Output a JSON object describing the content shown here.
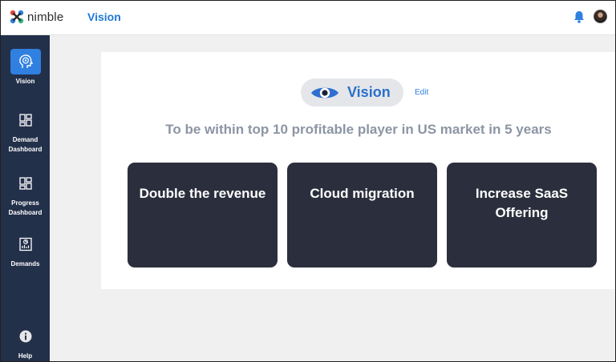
{
  "app": {
    "brand": "nimble",
    "page_title": "Vision"
  },
  "sidebar": {
    "items": [
      {
        "label": "Vision",
        "icon": "target-head-icon",
        "active": true
      },
      {
        "label": "Demand Dashboard",
        "icon": "grid-layout-icon",
        "active": false
      },
      {
        "label": "Progress Dashboard",
        "icon": "grid-layout-icon",
        "active": false
      },
      {
        "label": "Demands",
        "icon": "chart-clipboard-icon",
        "active": false
      }
    ],
    "help": {
      "label": "Help",
      "icon": "info-icon"
    }
  },
  "vision": {
    "pill_label": "Vision",
    "edit_label": "Edit",
    "statement": "To be within top 10 profitable player in US market in 5 years",
    "goals": [
      "Double the revenue",
      "Cloud migration",
      "Increase SaaS Offering"
    ]
  },
  "colors": {
    "accent": "#2f80e0",
    "sidebar_bg": "#23304a",
    "goal_card_bg": "#2b2f3d",
    "statement_text": "#8c95a3"
  }
}
